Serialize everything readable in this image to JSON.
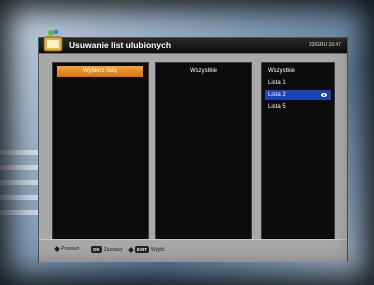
{
  "window": {
    "title": "Usuwanie list ulubionych",
    "clock": "23/GRU 16:47"
  },
  "columns": {
    "select_button_label": "Wybierz listę",
    "middle_header": "Wszystkie",
    "lists": [
      {
        "label": "Wszystkie"
      },
      {
        "label": "Lista 1"
      },
      {
        "label": "Lista 2"
      },
      {
        "label": "Lista 5"
      }
    ],
    "selected_index": 2
  },
  "footer": {
    "move_label": "Przesuń",
    "ok_key": "OK",
    "ok_label": "Zaznacz",
    "exit_key": "EXIT",
    "exit_label": "Wyjdź"
  },
  "colors": {
    "accent_orange": "#f09a2e",
    "selection_blue": "#1c43b5",
    "panel_bg": "#0c0c0c",
    "window_bg": "#a9a9a9"
  }
}
